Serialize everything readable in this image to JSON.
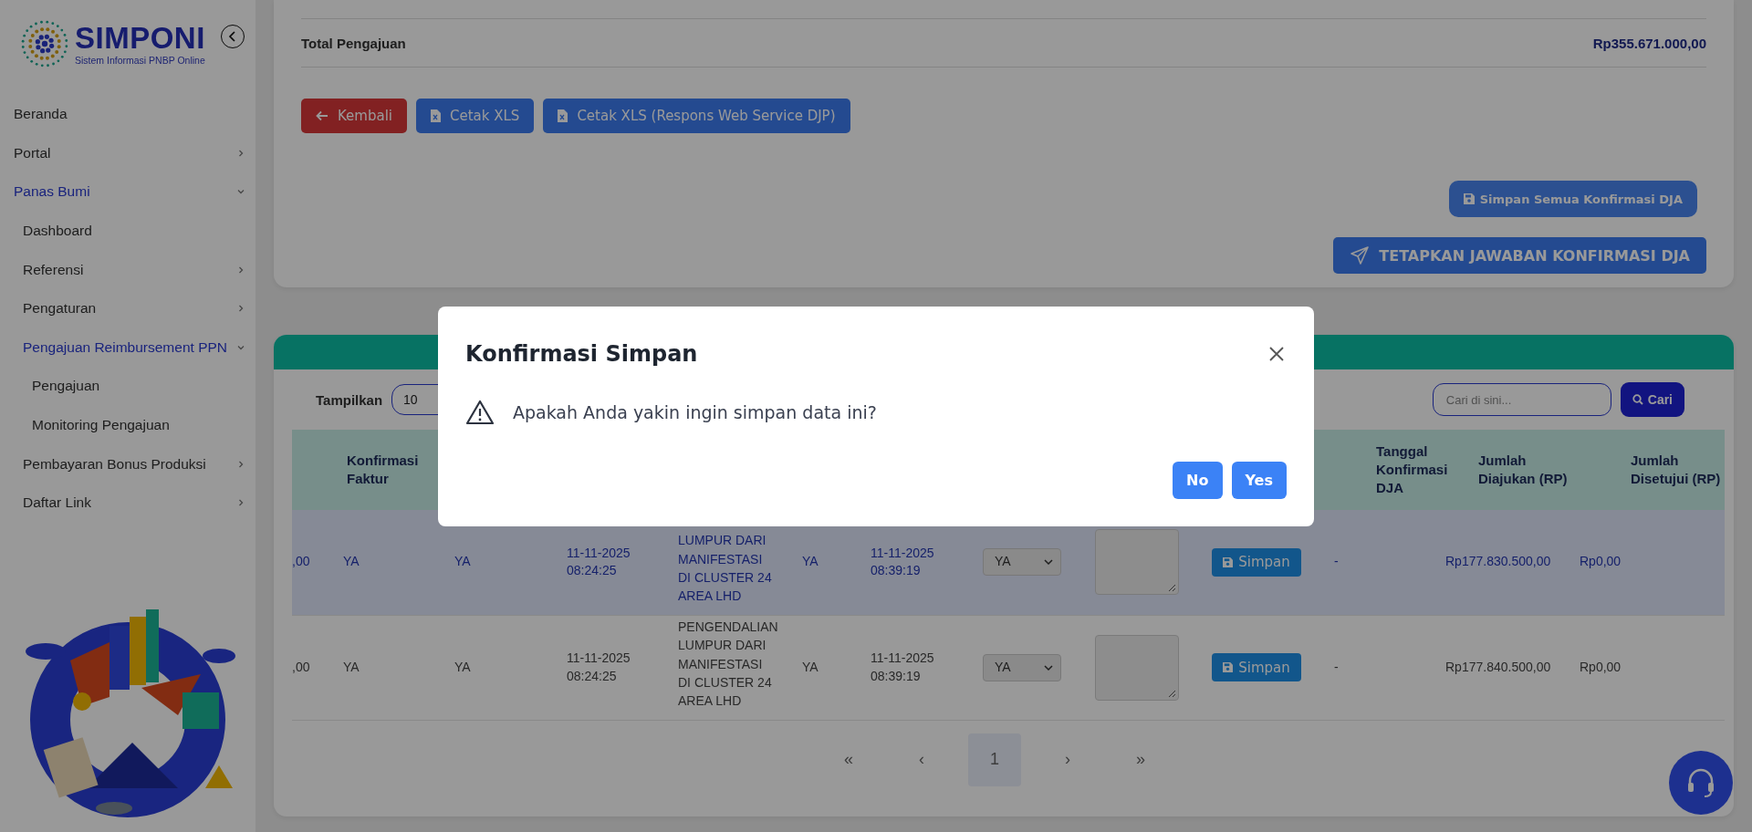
{
  "sidebar": {
    "logo": {
      "title": "SIMPONI",
      "subtitle": "Sistem Informasi PNBP Online"
    },
    "items": [
      {
        "label": "Beranda",
        "kind": "link"
      },
      {
        "label": "Portal",
        "kind": "menu",
        "expanded": false
      },
      {
        "label": "Panas Bumi",
        "kind": "menu",
        "expanded": true,
        "children": [
          {
            "label": "Dashboard",
            "kind": "link"
          },
          {
            "label": "Referensi",
            "kind": "menu",
            "expanded": false
          },
          {
            "label": "Pengaturan",
            "kind": "menu",
            "expanded": false
          },
          {
            "label": "Pengajuan Reimbursement PPN",
            "kind": "menu",
            "expanded": true,
            "children": [
              {
                "label": "Pengajuan",
                "kind": "link"
              },
              {
                "label": "Monitoring Pengajuan",
                "kind": "link"
              }
            ]
          },
          {
            "label": "Pembayaran Bonus Produksi",
            "kind": "menu",
            "expanded": false
          },
          {
            "label": "Daftar Link",
            "kind": "menu",
            "expanded": false
          }
        ]
      }
    ]
  },
  "summary": {
    "label": "Total Pengajuan",
    "value": "Rp355.671.000,00"
  },
  "actions": [
    {
      "kind": "back",
      "label": "Kembali"
    },
    {
      "kind": "xls",
      "label": "Cetak XLS"
    },
    {
      "kind": "xls",
      "label": "Cetak XLS (Respons Web Service DJP)"
    }
  ],
  "save_all_button": "Simpan Semua Konfirmasi DJA",
  "submit_button": "TETAPKAN JAWABAN KONFIRMASI DJA",
  "table": {
    "show_label": "Tampilkan",
    "page_size": "10",
    "search": {
      "placeholder": "Cari di sini..."
    },
    "search_button": "Cari",
    "columns": {
      "column_2": "Konfirmasi Faktur",
      "column_11": "Tanggal Konfirmasi DJA",
      "column_12": "Jumlah Diajukan (RP)",
      "column_13": "Jumlah Disetujui (RP)"
    },
    "rows": [
      {
        "highlighted": true,
        "cells": [
          ",00",
          "YA",
          "YA",
          "11-11-2025 08:24:25",
          "LUMPUR DARI MANIFESTASI DI CLUSTER 24 AREA LHD",
          "YA",
          "11-11-2025 08:39:19"
        ],
        "confirmation": "YA",
        "save_label": "Simpan",
        "tail": [
          "-",
          "Rp177.830.500,00",
          "Rp0,00"
        ]
      },
      {
        "highlighted": false,
        "cells": [
          ",00",
          "YA",
          "YA",
          "11-11-2025 08:24:25",
          "PENGENDALIAN LUMPUR DARI MANIFESTASI DI CLUSTER 24 AREA LHD",
          "YA",
          "11-11-2025 08:39:19"
        ],
        "confirmation": "YA",
        "save_label": "Simpan",
        "tail": [
          "-",
          "Rp177.840.500,00",
          "Rp0,00"
        ]
      }
    ],
    "pagination": {
      "first": "«",
      "prev": "‹",
      "pages": [
        {
          "label": "1",
          "selected": true
        }
      ],
      "next": "›",
      "last": "»"
    }
  },
  "modal": {
    "title": "Konfirmasi Simpan",
    "message": "Apakah Anda yakin ingin simpan data ini?",
    "buttons": [
      {
        "label": "No"
      },
      {
        "label": "Yes"
      }
    ]
  }
}
